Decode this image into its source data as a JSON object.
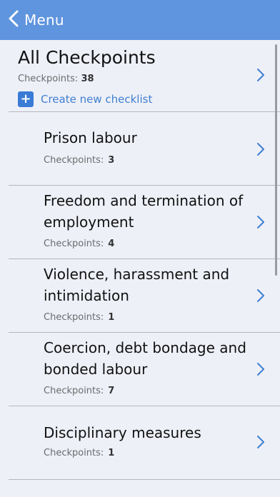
{
  "nav": {
    "back_label": "Menu"
  },
  "all_checkpoints": {
    "title": "All Checkpoints",
    "count_label": "Checkpoints:",
    "count": "38",
    "create_label": "Create new checklist"
  },
  "checklists": [
    {
      "name": "Prison labour",
      "count_label": "Checkpoints:",
      "count": "3"
    },
    {
      "name": "Freedom and termination of employment",
      "count_label": "Checkpoints:",
      "count": "4"
    },
    {
      "name": "Violence, harassment and intimidation",
      "count_label": "Checkpoints:",
      "count": "1"
    },
    {
      "name": "Coercion, debt bondage and bonded labour",
      "count_label": "Checkpoints:",
      "count": "7"
    },
    {
      "name": "Disciplinary measures",
      "count_label": "Checkpoints:",
      "count": "1"
    }
  ],
  "colors": {
    "nav_bar": "#5f94de",
    "accent": "#3f7fd1",
    "background": "#eef0f8"
  }
}
